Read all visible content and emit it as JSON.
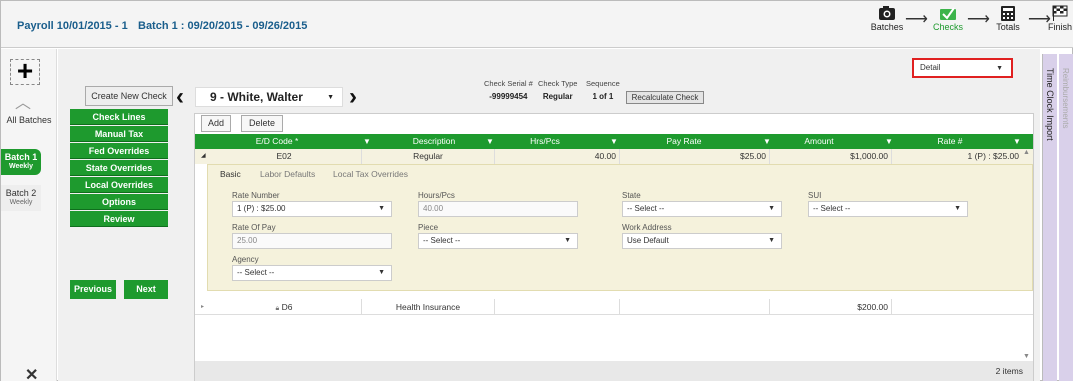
{
  "header": {
    "payroll_title": "Payroll 10/01/2015 - 1",
    "batch_title": "Batch 1 : 09/20/2015 - 09/26/2015",
    "steps": [
      {
        "label": "Batches",
        "icon": "camera-icon"
      },
      {
        "label": "Checks",
        "icon": "checks-icon"
      },
      {
        "label": "Totals",
        "icon": "calculator-icon"
      },
      {
        "label": "Finish",
        "icon": "checkered-flag-icon"
      }
    ],
    "active_step_color": "#1e9a2e"
  },
  "left_nav": {
    "add_icon": "+",
    "all_batches": "All Batches",
    "batch1_title": "Batch 1",
    "batch1_sub": "Weekly",
    "batch2_title": "Batch 2",
    "batch2_sub": "Weekly",
    "close_icon": "✕"
  },
  "actions": {
    "create_new_check": "Create New Check",
    "previous": "Previous",
    "next": "Next"
  },
  "check_menu": [
    "Check Lines",
    "Manual Tax",
    "Fed Overrides",
    "State Overrides",
    "Local Overrides",
    "Options",
    "Review"
  ],
  "employee": {
    "name": "9 - White, Walter"
  },
  "check_info": {
    "serial_label": "Check Serial #",
    "serial_value": "-99999454",
    "type_label": "Check Type",
    "type_value": "Regular",
    "sequence_label": "Sequence",
    "sequence_value": "1 of 1",
    "recalc": "Recalculate Check"
  },
  "view_select": "Detail",
  "grid": {
    "add": "Add",
    "delete": "Delete",
    "columns": [
      "E/D Code *",
      "Description",
      "Hrs/Pcs",
      "Pay Rate",
      "Amount",
      "Rate #"
    ],
    "rows": [
      {
        "code": "E02",
        "description": "Regular",
        "hrs": "40.00",
        "rate": "$25.00",
        "amount": "$1,000.00",
        "rate_no": "1 (P) : $25.00"
      },
      {
        "code": "D6",
        "description": "Health Insurance",
        "hrs": "",
        "rate": "",
        "amount": "$200.00",
        "rate_no": ""
      }
    ],
    "item_count": "2 items"
  },
  "detail_tabs": [
    "Basic",
    "Labor Defaults",
    "Local Tax Overrides"
  ],
  "detail_form": {
    "rate_number_label": "Rate Number",
    "rate_number_value": "1 (P) : $25.00",
    "hours_label": "Hours/Pcs",
    "hours_value": "40.00",
    "state_label": "State",
    "state_value": "-- Select --",
    "sui_label": "SUI",
    "sui_value": "-- Select --",
    "rate_of_pay_label": "Rate Of Pay",
    "rate_of_pay_value": "25.00",
    "piece_label": "Piece",
    "piece_value": "-- Select --",
    "work_address_label": "Work Address",
    "work_address_value": "Use Default",
    "agency_label": "Agency",
    "agency_value": "-- Select --"
  },
  "side_panels": {
    "time_clock": "Time Clock Import",
    "second": "Reimbursements"
  }
}
